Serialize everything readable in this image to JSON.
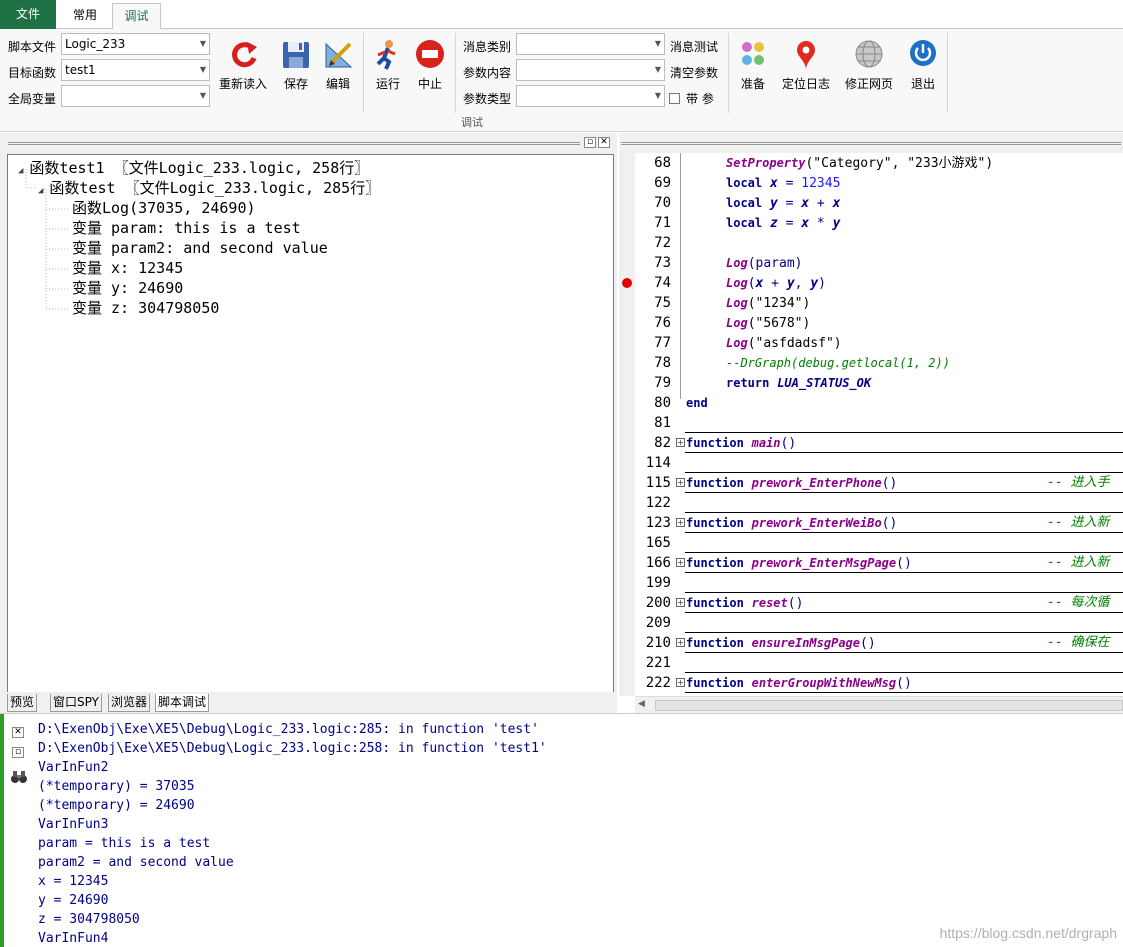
{
  "tabs": {
    "file": "文件",
    "common": "常用",
    "debug": "调试"
  },
  "ribbon": {
    "script_file_label": "脚本文件",
    "script_file_value": "Logic_233",
    "target_func_label": "目标函数",
    "target_func_value": "test1",
    "global_var_label": "全局变量",
    "global_var_value": "",
    "reload": "重新读入",
    "save": "保存",
    "edit": "编辑",
    "run": "运行",
    "stop": "中止",
    "msg_type_label": "消息类别",
    "param_content_label": "参数内容",
    "param_type_label": "参数类型",
    "msg_test": "消息测试",
    "clear_params": "清空参数",
    "with_param": "带 参",
    "prepare": "准备",
    "locate_log": "定位日志",
    "fix_page": "修正网页",
    "exit": "退出",
    "group_label": "调试"
  },
  "tree": [
    {
      "text": "函数test1 〖文件Logic_233.logic, 258行〗",
      "expanded": true
    },
    {
      "text": "函数test 〖文件Logic_233.logic, 285行〗",
      "expanded": true
    },
    {
      "text": "函数Log(37035, 24690)"
    },
    {
      "text": "变量 param: this is a test"
    },
    {
      "text": "变量 param2: and second value"
    },
    {
      "text": "变量 x: 12345"
    },
    {
      "text": "变量 y: 24690"
    },
    {
      "text": "变量 z: 304798050"
    }
  ],
  "bottom_tabs": [
    "预览",
    "窗口SPY",
    "浏览器",
    "脚本调试"
  ],
  "code": {
    "line_numbers": [
      "68",
      "69",
      "70",
      "71",
      "72",
      "73",
      "74",
      "75",
      "76",
      "77",
      "78",
      "79",
      "80",
      "81",
      "82",
      "114",
      "115",
      "122",
      "123",
      "165",
      "166",
      "199",
      "200",
      "209",
      "210",
      "221",
      "222"
    ],
    "l68_fn": "SetProperty",
    "l68_a": "(\"Category\", \"233小游戏\")",
    "local": "local",
    "x": "x",
    "y": "y",
    "z": "z",
    "eq": "=",
    "plus": "+",
    "times": "*",
    "n12345": "12345",
    "log": "Log",
    "l73_arg": "(param)",
    "l74_open": "(",
    "l74_comma": ", ",
    "l74_close": ")",
    "l75_arg": "(\"1234\")",
    "l76_arg": "(\"5678\")",
    "l77_arg": "(\"asfdadsf\")",
    "l78_comment": "--DrGraph(debug.getlocal(1, 2))",
    "return": "return",
    "status_ok": "LUA_STATUS_OK",
    "end": "end",
    "function": "function",
    "f_main": "main",
    "f_phone": "prework_EnterPhone",
    "f_weibo": "prework_EnterWeiBo",
    "f_msgpage": "prework_EnterMsgPage",
    "f_reset": "reset",
    "f_ensure": "ensureInMsgPage",
    "f_group": "enterGroupWithNewMsg",
    "parens": "()",
    "c_phone": "-- 进入手",
    "c_weibo": "-- 进入新",
    "c_msgpage": "-- 进入新",
    "c_reset": "-- 每次循",
    "c_ensure": "-- 确保在"
  },
  "output": [
    "D:\\ExenObj\\Exe\\XE5\\Debug\\Logic_233.logic:285: in function 'test'",
    "D:\\ExenObj\\Exe\\XE5\\Debug\\Logic_233.logic:258: in function 'test1'",
    "VarInFun2",
    "(*temporary) = 37035",
    "(*temporary) = 24690",
    "VarInFun3",
    "param = this is a test",
    "param2 = and second value",
    "x = 12345",
    "y = 24690",
    "z = 304798050",
    "VarInFun4"
  ],
  "watermark": "https://blog.csdn.net/drgraph",
  "colors": {
    "file_tab": "#1e7145",
    "keyword": "#00008b",
    "function_name": "#8b008b",
    "comment": "#008000",
    "breakpoint": "#e00000",
    "output_text": "#00008b"
  }
}
